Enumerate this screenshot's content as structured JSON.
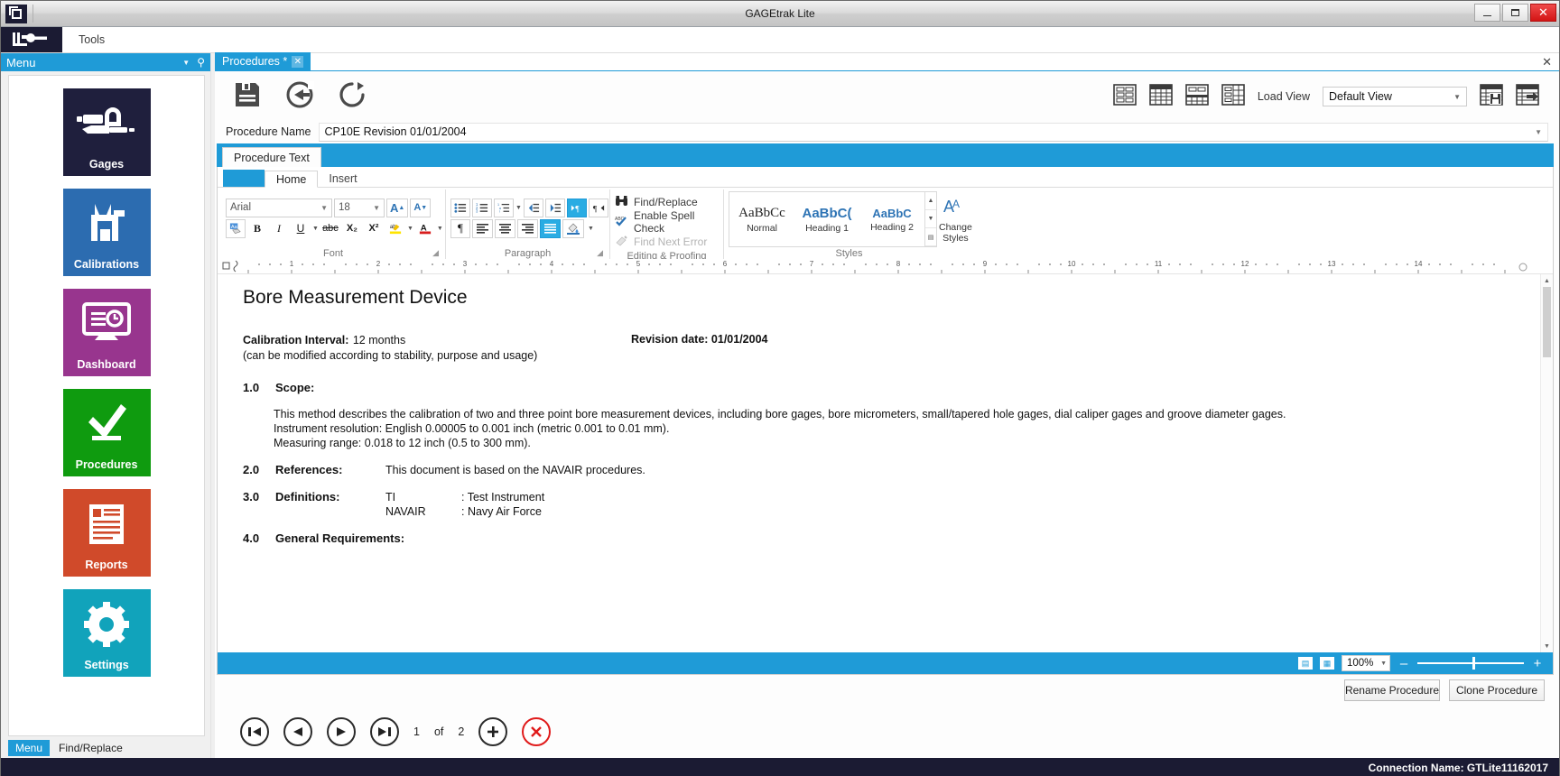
{
  "window": {
    "title": "GAGEtrak Lite",
    "icon": "app-window-icon",
    "minimize": "–",
    "maximize": "▢",
    "close": "✕"
  },
  "menustrip": {
    "logo_icon": "caliper-logo-icon",
    "tools_label": "Tools"
  },
  "sidebar": {
    "header": "Menu",
    "caret_icon": "chevron-down-icon",
    "pin_icon": "pin-icon",
    "items": [
      {
        "label": "Gages",
        "color": "#1f1f3d",
        "icon": "micrometer-icon"
      },
      {
        "label": "Calibrations",
        "color": "#2c6cb0",
        "icon": "caliper-icon"
      },
      {
        "label": "Dashboard",
        "color": "#98358e",
        "icon": "monitor-clock-icon"
      },
      {
        "label": "Procedures",
        "color": "#0f9b0f",
        "icon": "checkmark-icon"
      },
      {
        "label": "Reports",
        "color": "#d04a2a",
        "icon": "document-lines-icon"
      },
      {
        "label": "Settings",
        "color": "#11a3bb",
        "icon": "gear-icon"
      }
    ],
    "footer_menu": "Menu",
    "footer_find": "Find/Replace"
  },
  "doctab": {
    "label": "Procedures *",
    "close_icon": "close-icon",
    "pane_close_icon": "close-icon"
  },
  "toolbar": {
    "save_icon": "save-icon",
    "undo_icon": "undo-icon",
    "refresh_icon": "refresh-icon",
    "view_icons": [
      "layout-form-icon",
      "layout-grid-icon",
      "layout-split-icon",
      "layout-columns-icon"
    ],
    "load_view_label": "Load View",
    "load_view_value": "Default View",
    "load_view_caret": "▼",
    "save_view_icon": "save-view-icon",
    "export_view_icon": "export-view-icon"
  },
  "procedure": {
    "name_label": "Procedure Name",
    "name_value": "CP10E Revision 01/01/2004",
    "name_caret": "▼",
    "section_tab": "Procedure Text"
  },
  "ribbon": {
    "tabs": [
      {
        "label": "",
        "kind": "blue"
      },
      {
        "label": "Home",
        "kind": "active"
      },
      {
        "label": "Insert",
        "kind": "normal"
      }
    ],
    "font_group": {
      "name": "Font",
      "font_family": "Arial",
      "font_size": "18",
      "grow_font": "A",
      "shrink_font": "A",
      "clear_format_icon": "clear-formatting-icon",
      "bold": "B",
      "italic": "I",
      "underline": "U",
      "strike": "abc",
      "subscript": "X₂",
      "superscript": "X²",
      "highlight_icon": "text-highlight-icon",
      "fontcolor_icon": "font-color-icon",
      "dialog_launcher": "◥"
    },
    "paragraph_group": {
      "name": "Paragraph",
      "bullets_icon": "bullet-list-icon",
      "numbering_icon": "numbered-list-icon",
      "multilevel_icon": "multilevel-list-icon",
      "decrease_indent_icon": "decrease-indent-icon",
      "increase_indent_icon": "increase-indent-icon",
      "ltr_icon": "left-to-right-icon",
      "rtl_icon": "right-to-left-icon",
      "pilcrow_icon": "show-marks-icon",
      "align_left_icon": "align-left-icon",
      "align_center_icon": "align-center-icon",
      "align_right_icon": "align-right-icon",
      "align_justify_icon": "align-justify-icon",
      "shading_icon": "shading-icon",
      "dialog_launcher": "◥"
    },
    "editing_group": {
      "name": "Editing & Proofing",
      "items": [
        {
          "label": "Find/Replace",
          "icon": "binoculars-icon",
          "disabled": false
        },
        {
          "label": "Enable Spell Check",
          "icon": "spellcheck-icon",
          "disabled": false
        },
        {
          "label": "Find Next Error",
          "icon": "find-next-error-icon",
          "disabled": true
        }
      ]
    },
    "styles_group": {
      "name": "Styles",
      "items": [
        {
          "preview": "AaBbCc",
          "label": "Normal",
          "style": "normal"
        },
        {
          "preview": "AaBbC(",
          "label": "Heading 1",
          "style": "h1"
        },
        {
          "preview": "AaBbC",
          "label": "Heading 2",
          "style": "h2"
        }
      ],
      "scroll_up": "▲",
      "scroll_down": "▼",
      "scroll_more": "▤",
      "change_styles_icon": "change-styles-icon",
      "change_styles_label_1": "Change",
      "change_styles_label_2": "Styles"
    }
  },
  "ruler": {
    "marks": [
      "1",
      "2",
      "3",
      "4",
      "5",
      "6",
      "7",
      "8",
      "9",
      "10",
      "11",
      "12",
      "13",
      "14"
    ],
    "tab_stop_icon": "tab-stop-icon",
    "indent_icon": "indent-marker-icon",
    "right_marker_icon": "right-indent-icon"
  },
  "document": {
    "title": "Bore Measurement Device",
    "calibration_interval_label": "Calibration Interval:",
    "calibration_interval_value": "12 months",
    "revision_date": "Revision date: 01/01/2004",
    "calibration_note": "(can be modified according to stability, purpose and usage)",
    "sections": [
      {
        "num": "1.0",
        "heading": "Scope:",
        "inline": "",
        "body": [
          "This method describes the calibration of two and three point bore measurement devices, including bore gages, bore micrometers, small/tapered hole gages, dial caliper gages and groove diameter gages.",
          "Instrument resolution:  English 0.00005 to 0.001 inch (metric 0.001 to 0.01 mm).",
          "Measuring range:  0.018 to 12 inch (0.5 to 300 mm)."
        ]
      },
      {
        "num": "2.0",
        "heading": "References:",
        "inline": "This document is based on the NAVAIR procedures.",
        "body": []
      },
      {
        "num": "3.0",
        "heading": "Definitions:",
        "inline": "",
        "defs": [
          {
            "term": "TI",
            "meaning": ": Test Instrument"
          },
          {
            "term": "NAVAIR",
            "meaning": ": Navy Air Force"
          }
        ],
        "body": []
      },
      {
        "num": "4.0",
        "heading": "General Requirements:",
        "inline": "",
        "body": []
      }
    ],
    "scroll_up_icon": "scroll-up-icon",
    "scroll_down_icon": "scroll-down-icon"
  },
  "zoombar": {
    "page_view_icon": "page-view-icon",
    "web_view_icon": "web-view-icon",
    "zoom_value": "100%",
    "zoom_caret": "▼",
    "minus": "–",
    "plus": "+"
  },
  "lower_buttons": {
    "rename": "Rename Procedure",
    "clone": "Clone Procedure"
  },
  "navigator": {
    "first_icon": "first-record-icon",
    "prev_icon": "previous-record-icon",
    "next_icon": "next-record-icon",
    "last_icon": "last-record-icon",
    "current_page": "1",
    "of_label": "of",
    "total_pages": "2",
    "add_icon": "add-record-icon",
    "delete_icon": "delete-record-icon"
  },
  "statusbar": {
    "connection": "Connection Name: GTLite11162017"
  },
  "colors": {
    "accent": "#1f9bd7",
    "dark": "#1b1b33",
    "danger": "#e01b1b"
  }
}
